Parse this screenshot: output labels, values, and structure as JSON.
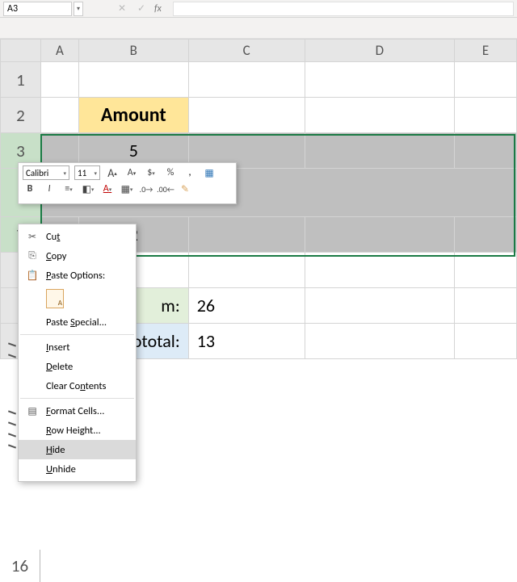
{
  "namebox": {
    "value": "A3"
  },
  "formula_bar": {
    "fx_label": "fx",
    "value": ""
  },
  "columns": [
    "A",
    "B",
    "C",
    "D",
    "E"
  ],
  "rows_visible": [
    "1",
    "2",
    "3",
    "7",
    "16"
  ],
  "cells": {
    "B2": "Amount",
    "B3": "5",
    "B7": "2",
    "B9_label": "m:",
    "C9": "26",
    "B10_label": "ototal:",
    "C10": "13"
  },
  "mini_toolbar": {
    "font": "Calibri",
    "size": "11",
    "items_row1": [
      "A↑",
      "A↓",
      "$",
      "%",
      ",",
      "table-icon"
    ],
    "items_row2": [
      "B",
      "I",
      "align",
      "fill",
      "font-color",
      "border",
      "dec-inc",
      "dec-dec",
      "format-painter"
    ]
  },
  "context_menu": {
    "items": [
      {
        "icon": "cut-icon",
        "label": "Cut",
        "accel": "t"
      },
      {
        "icon": "copy-icon",
        "label": "Copy",
        "accel": "C"
      },
      {
        "icon": "paste-icon",
        "label": "Paste Options:",
        "accel": "P"
      },
      {
        "icon": "",
        "label": "Paste Special...",
        "accel": "S",
        "sub": true
      },
      {
        "sep": true
      },
      {
        "icon": "",
        "label": "Insert",
        "accel": "I"
      },
      {
        "icon": "",
        "label": "Delete",
        "accel": "D"
      },
      {
        "icon": "",
        "label": "Clear Contents",
        "accel": "N"
      },
      {
        "sep": true
      },
      {
        "icon": "format-cells-icon",
        "label": "Format Cells...",
        "accel": "F"
      },
      {
        "icon": "",
        "label": "Row Height...",
        "accel": "R"
      },
      {
        "icon": "",
        "label": "Hide",
        "accel": "H",
        "hover": true
      },
      {
        "icon": "",
        "label": "Unhide",
        "accel": "U"
      }
    ]
  },
  "labels": {
    "cut": "Cut",
    "copy": "Copy",
    "paste_options": "Paste Options:",
    "paste_special": "Paste Special...",
    "insert": "Insert",
    "delete": "Delete",
    "clear": "Clear Contents",
    "format_cells": "Format Cells...",
    "row_height": "Row Height...",
    "hide": "Hide",
    "unhide": "Unhide"
  }
}
